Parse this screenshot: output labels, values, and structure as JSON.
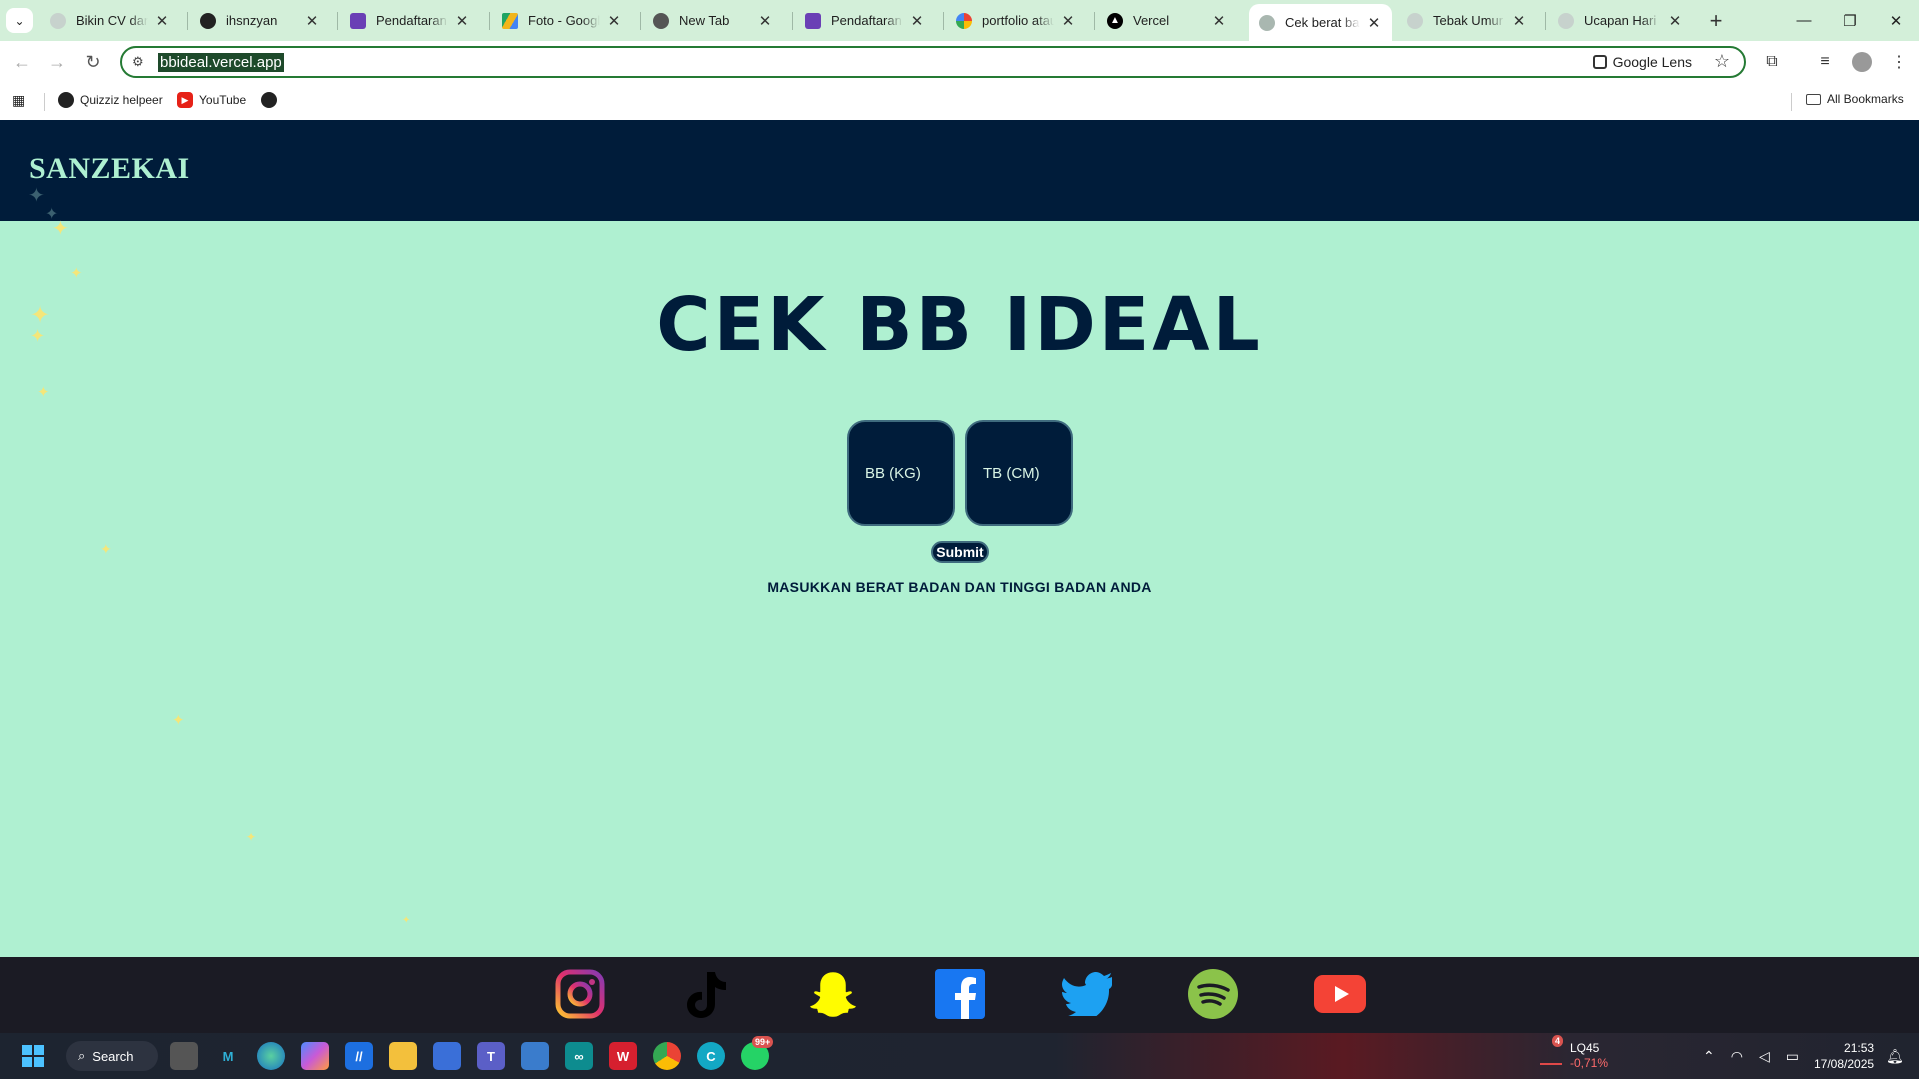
{
  "browser": {
    "tabs": [
      {
        "title": "Bikin CV dan portfolio",
        "icon": "globe-icon",
        "color": "#9aa3a0"
      },
      {
        "title": "ihsnzyan",
        "icon": "github-icon",
        "color": "#222"
      },
      {
        "title": "Pendaftaran Anggota",
        "icon": "forms-icon",
        "color": "#6a3fb5"
      },
      {
        "title": "Foto - Google Drive",
        "icon": "drive-icon",
        "color": "#f2b51a"
      },
      {
        "title": "New Tab",
        "icon": "chrome-icon",
        "color": "#555"
      },
      {
        "title": "Pendaftaran Anggota",
        "icon": "forms-icon",
        "color": "#6a3fb5"
      },
      {
        "title": "portfolio atau portofolio",
        "icon": "google-icon",
        "color": "#4285f4"
      },
      {
        "title": "Vercel",
        "icon": "vercel-icon",
        "color": "#000"
      },
      {
        "title": "Cek berat badan ideal",
        "icon": "globe-icon",
        "color": "#8b9a93",
        "active": true
      },
      {
        "title": "Tebak Umur",
        "icon": "globe-icon",
        "color": "#9aa3a0"
      },
      {
        "title": "Ucapan Hari Raya",
        "icon": "globe-icon",
        "color": "#9aa3a0"
      }
    ],
    "url": "bbideal.vercel.app",
    "lens_label": "Google Lens",
    "bookmarks": [
      {
        "label": "Quizziz helpeer",
        "icon": "globe-icon"
      },
      {
        "label": "YouTube",
        "icon": "youtube-icon"
      }
    ],
    "all_bookmarks_label": "All Bookmarks"
  },
  "page": {
    "brand": "SANZEKAI",
    "title": "CEK BB IDEAL",
    "weight_placeholder": "BB (KG)",
    "height_placeholder": "TB (CM)",
    "submit_label": "Submit",
    "instruction": "MASUKKAN BERAT BADAN DAN TINGGI BADAN ANDA",
    "social": [
      "instagram-icon",
      "tiktok-icon",
      "snapchat-icon",
      "facebook-icon",
      "twitter-icon",
      "spotify-icon",
      "youtube-icon"
    ],
    "colors": {
      "header_bg": "#001c3a",
      "page_bg": "#aff0d1",
      "footer_bg": "#1b1b24"
    }
  },
  "taskbar": {
    "search_label": "Search",
    "whatsapp_badge": "99+",
    "stock_badge": "4",
    "stock_name": "LQ45",
    "stock_change": "-0,71%",
    "time": "21:53",
    "date": "17/08/2025"
  }
}
